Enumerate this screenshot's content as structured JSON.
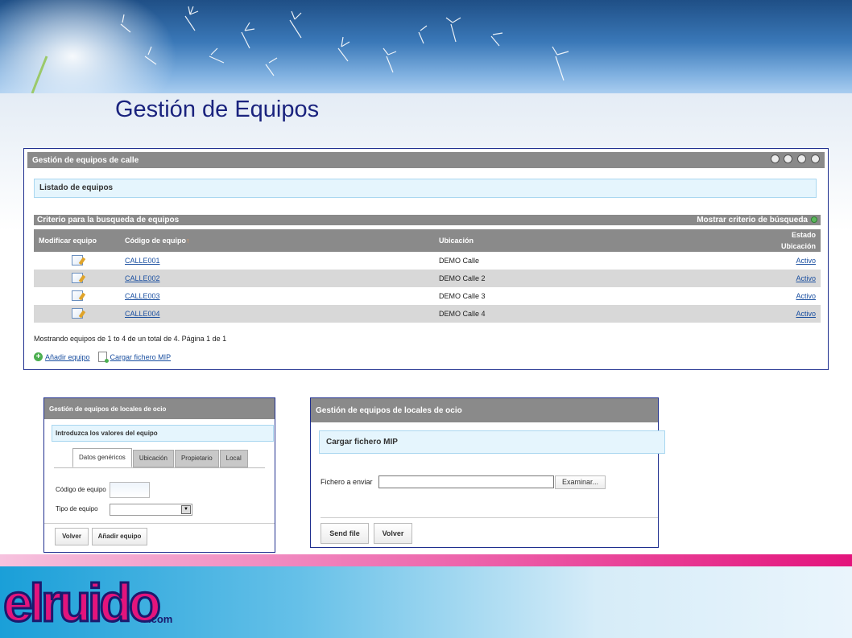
{
  "page": {
    "title": "Gestión de Equipos"
  },
  "main_panel": {
    "header": "Gestión de equipos de calle",
    "section": "Listado de equipos",
    "criteria_label": "Criterio para la busqueda de equipos",
    "criteria_toggle": "Mostrar criterio de búsqueda",
    "columns": [
      "Modificar equipo",
      "Código de equipo",
      "Ubicación",
      "Estado",
      "Ubicación"
    ],
    "sort_indicator": "↑",
    "rows": [
      {
        "code": "CALLE001",
        "location": "DEMO Calle",
        "status": "Activo"
      },
      {
        "code": "CALLE002",
        "location": "DEMO Calle 2",
        "status": "Activo"
      },
      {
        "code": "CALLE003",
        "location": "DEMO Calle 3",
        "status": "Activo"
      },
      {
        "code": "CALLE004",
        "location": "DEMO Calle 4",
        "status": "Activo"
      }
    ],
    "summary": "Mostrando equipos de 1 to 4 de un total de 4. Página 1 de 1",
    "add_link": "Añadir equipo",
    "upload_link": "Cargar fichero MIP"
  },
  "left_panel": {
    "header": "Gestión de equipos de locales de ocio",
    "section": "Introduzca los valores del equipo",
    "tabs": [
      "Datos genéricos",
      "Ubicación",
      "Propietario",
      "Local"
    ],
    "code_label": "Código de equipo",
    "type_label": "Tipo de equipo",
    "back_button": "Volver",
    "add_button": "Añadir equipo"
  },
  "right_panel": {
    "header": "Gestión de equipos de locales de ocio",
    "section": "Cargar fichero MIP",
    "file_label": "Fichero a enviar",
    "browse_button": "Examinar...",
    "send_button": "Send file",
    "back_button": "Volver"
  },
  "footer": {
    "logo_text": "elruido",
    "logo_suffix": ".com"
  },
  "colors": {
    "title": "#1a237e",
    "header_gray": "#8a8a8a",
    "link": "#1a4fa0",
    "pink": "#e3147c",
    "footer_blue": "#1a9fd8"
  }
}
